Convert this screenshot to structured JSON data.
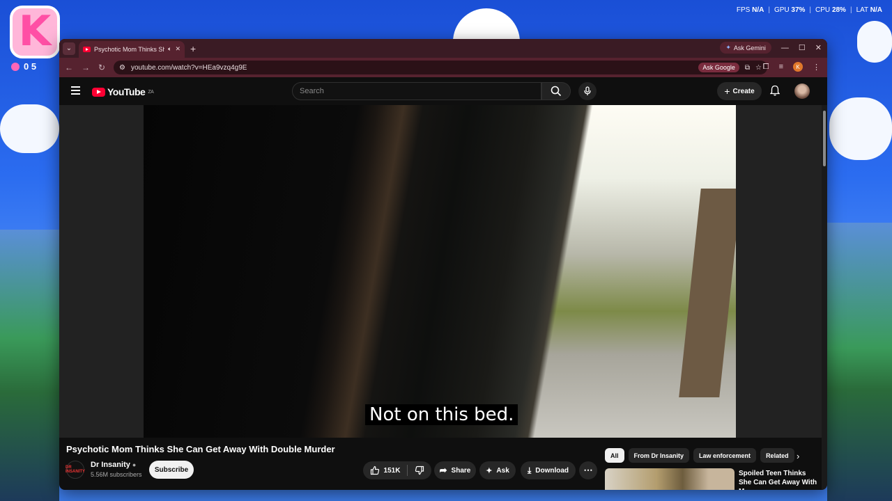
{
  "desktop": {
    "logo_letter": "K",
    "counter": "0   5",
    "hud": [
      {
        "label": "FPS",
        "value": "N/A"
      },
      {
        "label": "GPU",
        "value": "37%"
      },
      {
        "label": "CPU",
        "value": "28%"
      },
      {
        "label": "LAT",
        "value": "N/A"
      }
    ]
  },
  "browser": {
    "tab_title": "Psychotic Mom Thinks She",
    "ask_gemini": "Ask Gemini",
    "url": "youtube.com/watch?v=HEa9vzq4g9E",
    "ask_google": "Ask Google",
    "profile_initial": "K"
  },
  "youtube": {
    "logo_text": "YouTube",
    "country": "ZA",
    "search_placeholder": "Search",
    "create_label": "Create",
    "caption": "Not on this bed.",
    "video_title": "Psychotic Mom Thinks She Can Get Away With Double Murder",
    "channel_name": "Dr Insanity",
    "channel_avatar_text": "DR INSANITY",
    "subscribers": "5.56M subscribers",
    "subscribe_label": "Subscribe",
    "likes": "151K",
    "share_label": "Share",
    "ask_label": "Ask",
    "download_label": "Download",
    "chips": [
      "All",
      "From Dr Insanity",
      "Law enforcement",
      "Related"
    ],
    "recommendation_title": "Spoiled Teen Thinks She Can Get Away With M..."
  }
}
